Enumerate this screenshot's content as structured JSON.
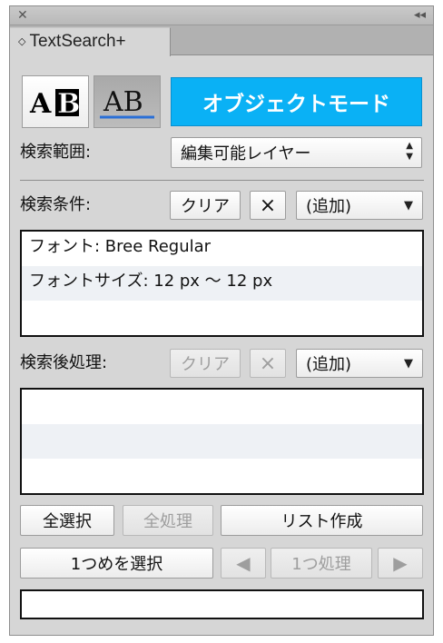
{
  "panel": {
    "close_glyph": "✕",
    "collapse_glyph": "◂◂",
    "tab_arrows": "◇",
    "tab_label": "TextSearch+"
  },
  "mode_buttons": {
    "outline_text": "AB",
    "underline_text": "AB",
    "object_mode_label": "オブジェクトモード",
    "object_mode_color": "#0ab1f5"
  },
  "search_scope": {
    "label": "検索範囲:",
    "selected": "編集可能レイヤー"
  },
  "search_conditions": {
    "label": "検索条件:",
    "clear_label": "クリア",
    "remove_label": "×",
    "add_label": "(追加)",
    "items": [
      "フォント: Bree Regular",
      "フォントサイズ: 12 px 〜 12 px",
      ""
    ]
  },
  "post_processing": {
    "label": "検索後処理:",
    "clear_label": "クリア",
    "remove_label": "×",
    "add_label": "(追加)",
    "items": [
      "",
      "",
      ""
    ]
  },
  "actions": {
    "select_all": "全選択",
    "process_all": "全処理",
    "create_list": "リスト作成",
    "select_first": "1つめを選択",
    "prev_glyph": "◀",
    "process_one": "1つ処理",
    "next_glyph": "▶"
  },
  "status_text": ""
}
